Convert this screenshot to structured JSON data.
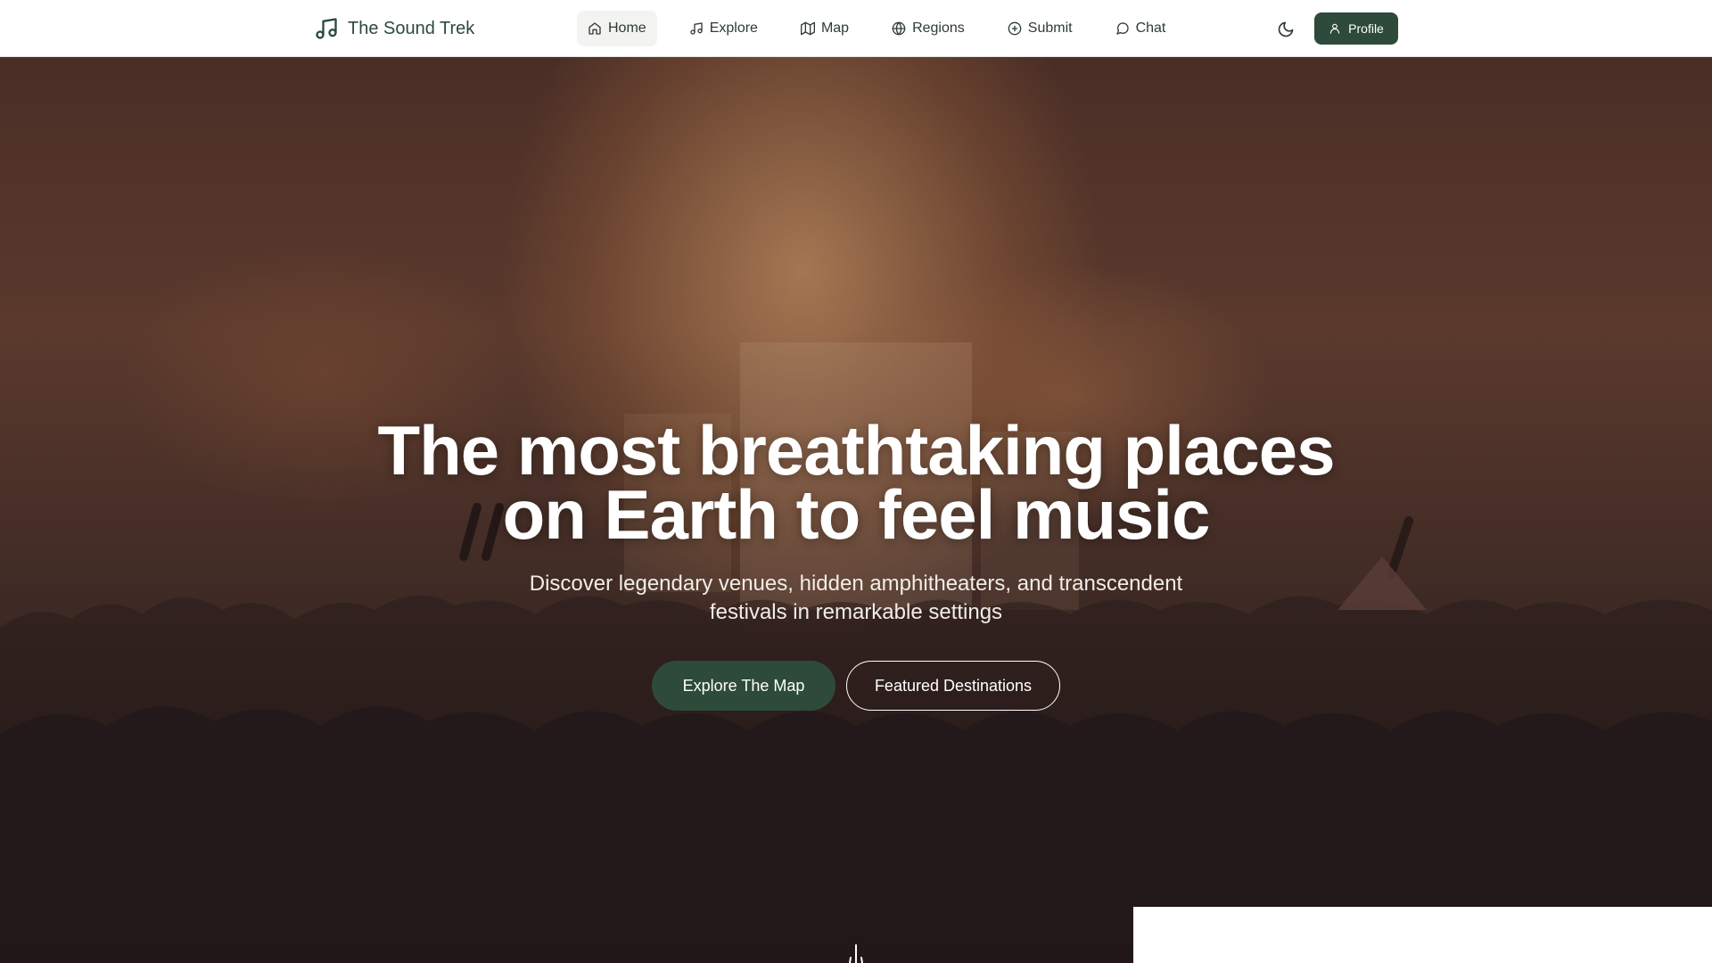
{
  "brand": {
    "name": "The Sound Trek",
    "icon": "music-note-icon"
  },
  "nav": {
    "items": [
      {
        "label": "Home",
        "icon": "home-icon",
        "active": true
      },
      {
        "label": "Explore",
        "icon": "music-note-icon",
        "active": false
      },
      {
        "label": "Map",
        "icon": "map-icon",
        "active": false
      },
      {
        "label": "Regions",
        "icon": "globe-icon",
        "active": false
      },
      {
        "label": "Submit",
        "icon": "plus-circle-icon",
        "active": false
      },
      {
        "label": "Chat",
        "icon": "chat-bubble-icon",
        "active": false
      }
    ],
    "theme_toggle_icon": "moon-icon",
    "profile_label": "Profile",
    "profile_icon": "user-icon"
  },
  "hero": {
    "headline_line1": "The most breathtaking places",
    "headline_line2": "on Earth to feel music",
    "subline": "Discover legendary venues, hidden amphitheaters, and transcendent festivals in remarkable settings",
    "cta_primary": "Explore The Map",
    "cta_secondary": "Featured Destinations"
  },
  "colors": {
    "accent": "#2d4a3a",
    "nav_bg": "#ffffff",
    "text_on_hero": "#ffffff"
  }
}
